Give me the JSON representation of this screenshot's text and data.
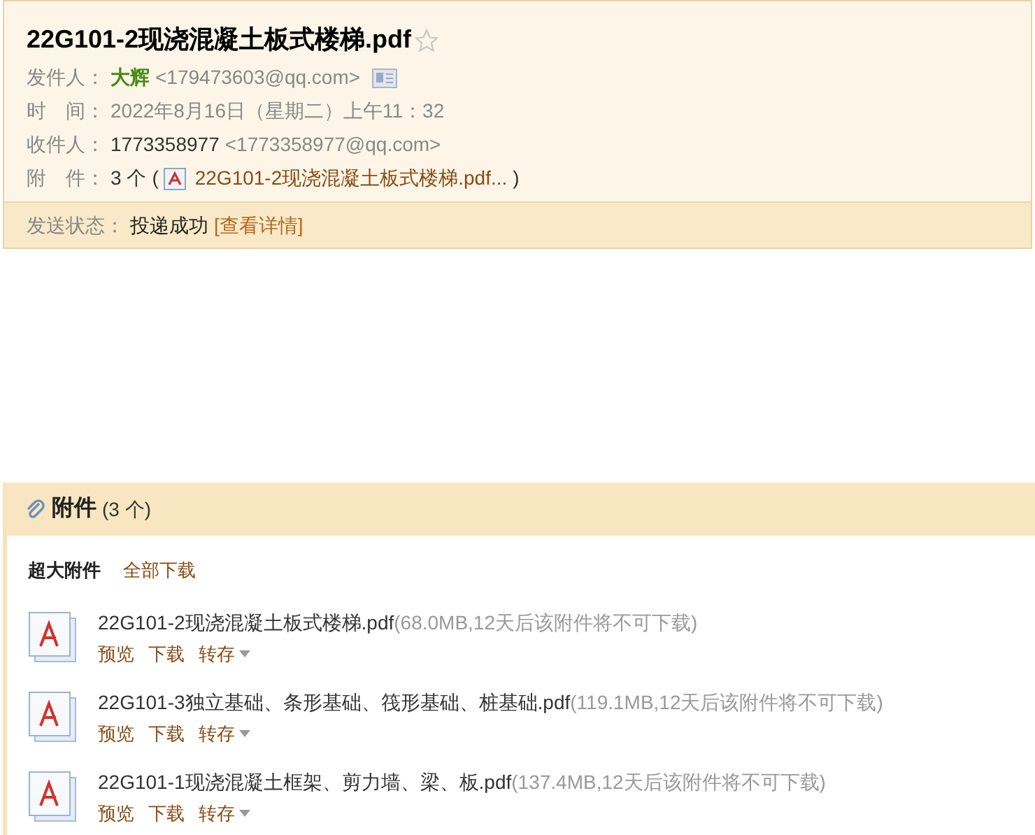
{
  "subject": "22G101-2现浇混凝土板式楼梯.pdf",
  "sender": {
    "label": "发件人：",
    "name": "大辉",
    "address": "<179473603@qq.com>"
  },
  "time": {
    "label": "时　间：",
    "value": "2022年8月16日（星期二）上午11：32"
  },
  "recipient": {
    "label": "收件人：",
    "name": "1773358977",
    "address": "<1773358977@qq.com>"
  },
  "attachment_summary": {
    "label": "附　件：",
    "count": "3 个",
    "open": "(",
    "file": "22G101-2现浇混凝土板式楼梯.pdf...",
    "close": ")"
  },
  "send_status": {
    "label": "发送状态：",
    "value": "投递成功",
    "details": "[查看详情]"
  },
  "attachments": {
    "title": "附件",
    "count": "(3 个)",
    "section": "超大附件",
    "download_all": "全部下载",
    "files": [
      {
        "name": "22G101-2现浇混凝土板式楼梯.pdf",
        "info": "(68.0MB,12天后该附件将不可下载)",
        "actions": [
          "预览",
          "下载",
          "转存"
        ]
      },
      {
        "name": "22G101-3独立基础、条形基础、筏形基础、桩基础.pdf",
        "info": "(119.1MB,12天后该附件将不可下载)",
        "actions": [
          "预览",
          "下载",
          "转存"
        ]
      },
      {
        "name": "22G101-1现浇混凝土框架、剪力墙、梁、板.pdf",
        "info": "(137.4MB,12天后该附件将不可下载)",
        "actions": [
          "预览",
          "下载",
          "转存"
        ]
      }
    ]
  }
}
